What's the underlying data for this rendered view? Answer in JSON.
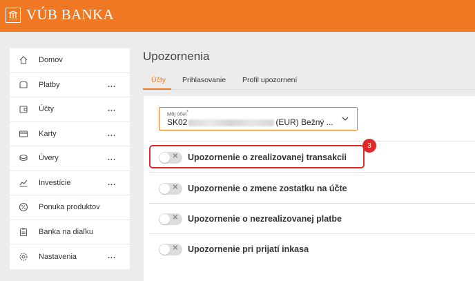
{
  "brand": {
    "name": "VÚB BANKA"
  },
  "sidebar": {
    "items": [
      {
        "label": "Domov",
        "icon": "home-icon",
        "more": ""
      },
      {
        "label": "Platby",
        "icon": "wallet-icon",
        "more": "..."
      },
      {
        "label": "Účty",
        "icon": "account-icon",
        "more": "..."
      },
      {
        "label": "Karty",
        "icon": "card-icon",
        "more": "..."
      },
      {
        "label": "Úvery",
        "icon": "loan-icon",
        "more": "..."
      },
      {
        "label": "Investície",
        "icon": "chart-line-icon",
        "more": "..."
      },
      {
        "label": "Ponuka produktov",
        "icon": "percent-icon",
        "more": ""
      },
      {
        "label": "Banka na diaľku",
        "icon": "clipboard-icon",
        "more": ""
      },
      {
        "label": "Nastavenia",
        "icon": "gear-icon",
        "more": "..."
      }
    ]
  },
  "main": {
    "title": "Upozornenia",
    "tabs": [
      {
        "label": "Účty",
        "active": true
      },
      {
        "label": "Prihlasovanie",
        "active": false
      },
      {
        "label": "Profil upozornení",
        "active": false
      }
    ],
    "account_select": {
      "label": "Môj účet",
      "required_mark": "*",
      "value_prefix": "SK02",
      "value_suffix": "(EUR) Bežný ..."
    },
    "notifications": [
      {
        "label": "Upozornenie o zrealizovanej transakcii",
        "enabled": false
      },
      {
        "label": "Upozornenie o zmene zostatku na účte",
        "enabled": false
      },
      {
        "label": "Upozornenie o nezrealizovanej platbe",
        "enabled": false
      },
      {
        "label": "Upozornenie pri prijatí inkasa",
        "enabled": false
      }
    ],
    "toggle_off_mark": "✕"
  },
  "annotation": {
    "step": "3"
  },
  "colors": {
    "brand": "#f07822",
    "highlight": "#e02a2a"
  }
}
